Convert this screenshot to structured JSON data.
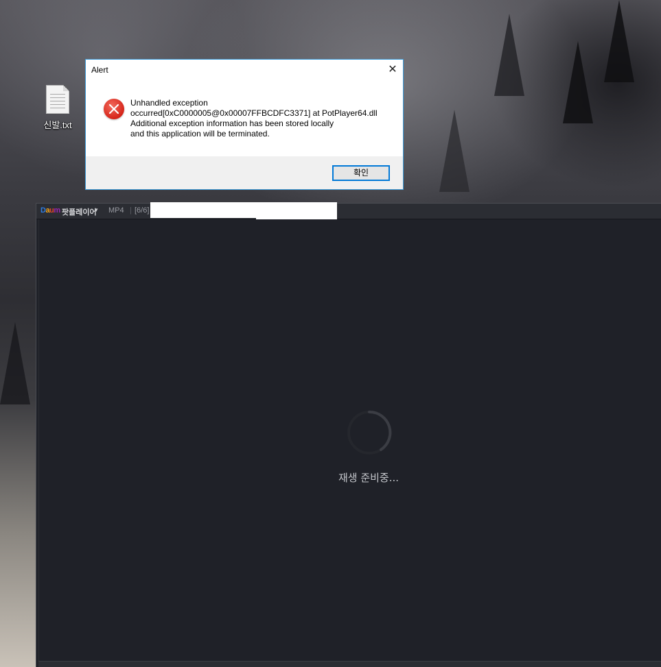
{
  "desktop": {
    "icons": [
      {
        "label": "신발.txt",
        "icon": "text-file-icon"
      }
    ]
  },
  "alert": {
    "title": "Alert",
    "icon": "error-icon",
    "message_lines": [
      "Unhandled exception",
      "occurred[0xC0000005@0x00007FFBCDFC3371] at PotPlayer64.dll",
      "Additional exception information has been stored locally",
      "and this application will be terminated."
    ],
    "ok_label": "확인",
    "close_icon": "close-icon",
    "accent": "#0078d7",
    "error_color": "#d6251a"
  },
  "player": {
    "app_name": "팟플레이어",
    "menu_arrow": "▾",
    "format": "MP4",
    "separator": "|",
    "playlist_position": "[6/6]",
    "loading_text": "재생 준비중...",
    "background": "#1f2128"
  }
}
